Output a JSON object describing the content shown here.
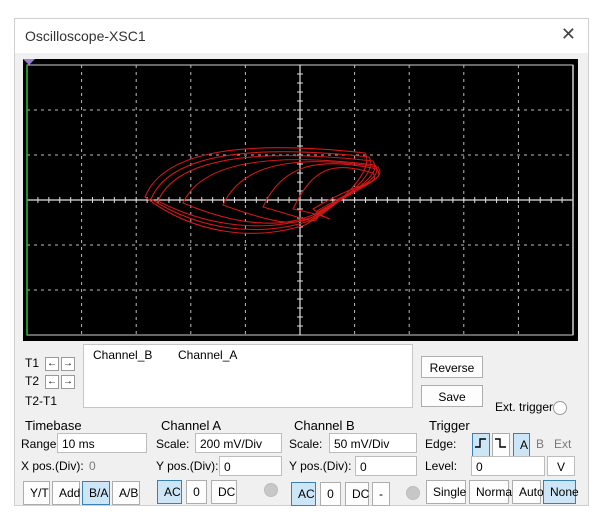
{
  "window": {
    "title": "Oscilloscope-XSC1",
    "close_icon": "close-icon"
  },
  "trace_color": "#d01818",
  "t_panel": {
    "t1": "T1",
    "t2": "T2",
    "t2t1": "T2-T1",
    "left_arrow": "←",
    "right_arrow": "→"
  },
  "readout": {
    "col1": "Channel_B",
    "col2": "Channel_A"
  },
  "buttons": {
    "reverse": "Reverse",
    "save": "Save",
    "ext_trigger": "Ext. trigger"
  },
  "timebase": {
    "heading": "Timebase",
    "range_label": "Range:",
    "range_value": "10 ms",
    "xpos_label": "X pos.(Div):",
    "xpos_value": "0",
    "modes": [
      "Y/T",
      "Add",
      "B/A",
      "A/B"
    ],
    "selected_mode": "B/A"
  },
  "channel_a": {
    "heading": "Channel A",
    "scale_label": "Scale:",
    "scale_value": "200 mV/Div",
    "ypos_label": "Y pos.(Div):",
    "ypos_value": "0",
    "coupling": [
      "AC",
      "0",
      "DC"
    ],
    "selected": "AC"
  },
  "channel_b": {
    "heading": "Channel B",
    "scale_label": "Scale:",
    "scale_value": "50 mV/Div",
    "ypos_label": "Y pos.(Div):",
    "ypos_value": "0",
    "coupling": [
      "AC",
      "0",
      "DC",
      "-"
    ],
    "selected": "AC"
  },
  "trigger": {
    "heading": "Trigger",
    "edge_label": "Edge:",
    "edges": [
      "A",
      "B",
      "Ext"
    ],
    "selected_edge": "A",
    "level_label": "Level:",
    "level_value": "0",
    "level_unit": "V",
    "modes": [
      "Single",
      "Normal",
      "Auto",
      "None"
    ],
    "selected_mode": "None"
  }
}
